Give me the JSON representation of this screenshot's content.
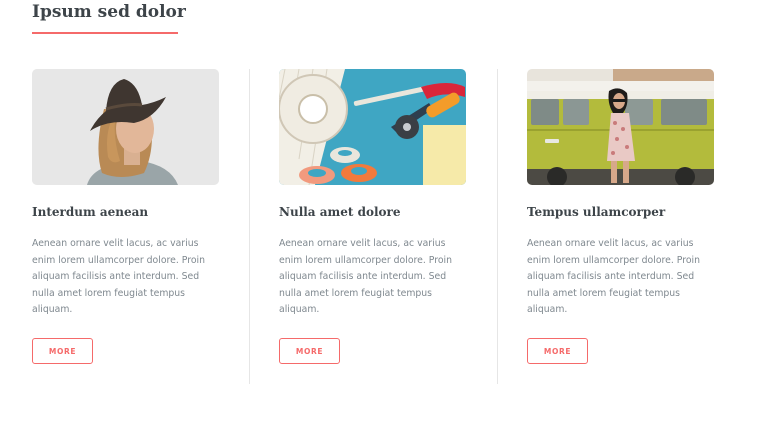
{
  "section": {
    "title": "Ipsum sed dolor",
    "accent_color": "#f56a6a"
  },
  "cards": [
    {
      "image": "woman-in-hat-photo",
      "title": "Interdum aenean",
      "text": "Aenean ornare velit lacus, ac varius enim lorem ullamcorper dolore. Proin aliquam facilisis ante interdum. Sed nulla amet lorem feugiat tempus aliquam.",
      "button_label": "MORE"
    },
    {
      "image": "craft-tools-photo",
      "title": "Nulla amet dolore",
      "text": "Aenean ornare velit lacus, ac varius enim lorem ullamcorper dolore. Proin aliquam facilisis ante interdum. Sed nulla amet lorem feugiat tempus aliquam.",
      "button_label": "MORE"
    },
    {
      "image": "woman-by-van-photo",
      "title": "Tempus ullamcorper",
      "text": "Aenean ornare velit lacus, ac varius enim lorem ullamcorper dolore. Proin aliquam facilisis ante interdum. Sed nulla amet lorem feugiat tempus aliquam.",
      "button_label": "MORE"
    }
  ]
}
